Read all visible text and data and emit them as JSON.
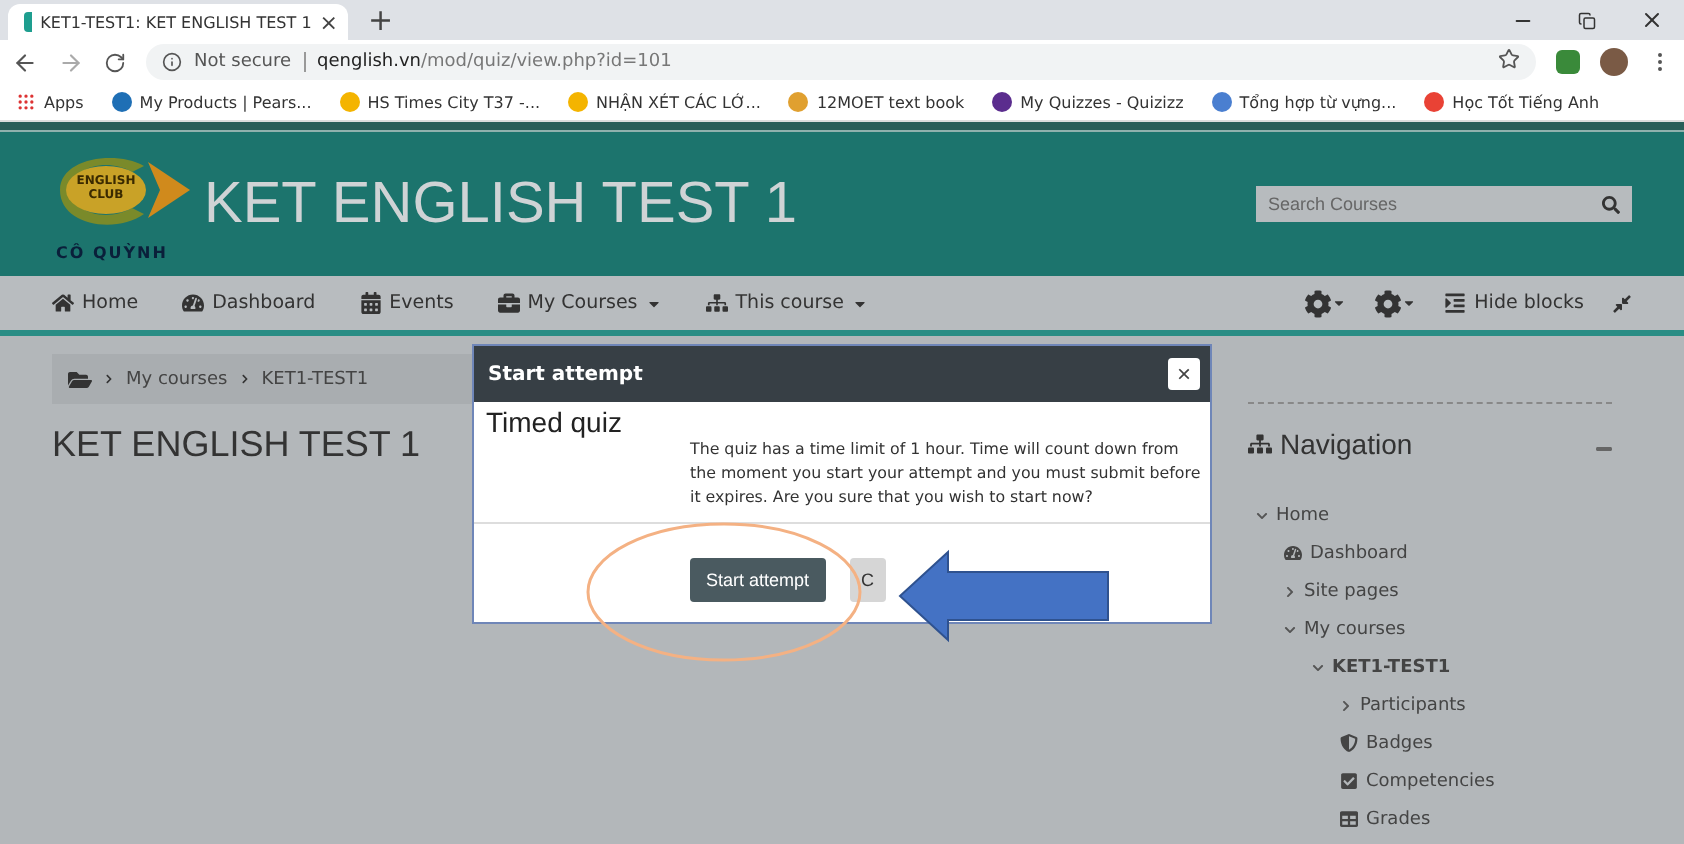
{
  "browser": {
    "tab": {
      "title": "KET1-TEST1: KET ENGLISH TEST 1",
      "close": "×"
    },
    "new_tab": "+",
    "security": "Not secure",
    "url_host": "qenglish.vn",
    "url_path": "/mod/quiz/view.php?id=101",
    "bookmarks": [
      "Apps",
      "My Products | Pears...",
      "HS Times City T37 -...",
      "NHẬN XÉT CÁC LỚ...",
      "12MOET text book",
      "My Quizzes - Quizizz",
      "Tổng hợp từ vựng...",
      "Học Tốt Tiếng Anh"
    ]
  },
  "header": {
    "logo_badge": "ENGLISH CLUB",
    "logo_caption": "CÔ QUỲNH",
    "title": "KET ENGLISH TEST 1",
    "search": {
      "placeholder": "Search Courses"
    }
  },
  "navbar": {
    "items": [
      {
        "label": "Home",
        "has_menu": false
      },
      {
        "label": "Dashboard",
        "has_menu": false
      },
      {
        "label": "Events",
        "has_menu": false
      },
      {
        "label": "My Courses",
        "has_menu": true
      },
      {
        "label": "This course",
        "has_menu": true
      }
    ],
    "hide_blocks": "Hide blocks"
  },
  "breadcrumb": [
    "My courses",
    "KET1-TEST1"
  ],
  "page_title": "KET ENGLISH TEST 1",
  "navigation": {
    "title": "Navigation",
    "tree": [
      {
        "label": "Home",
        "kind": "branch",
        "expanded": true,
        "current": false,
        "children": [
          {
            "label": "Dashboard",
            "kind": "leaf",
            "current": false
          },
          {
            "label": "Site pages",
            "kind": "branch",
            "expanded": false,
            "current": false
          },
          {
            "label": "My courses",
            "kind": "branch",
            "expanded": true,
            "current": false,
            "children": [
              {
                "label": "KET1-TEST1",
                "kind": "branch",
                "expanded": true,
                "current": true,
                "children": [
                  {
                    "label": "Participants",
                    "kind": "branch",
                    "expanded": false,
                    "current": false
                  },
                  {
                    "label": "Badges",
                    "kind": "leaf",
                    "current": false
                  },
                  {
                    "label": "Competencies",
                    "kind": "leaf",
                    "current": false
                  },
                  {
                    "label": "Grades",
                    "kind": "leaf",
                    "current": false
                  }
                ]
              }
            ]
          }
        ]
      }
    ]
  },
  "dialog": {
    "title": "Start attempt",
    "close": "×",
    "heading": "Timed quiz",
    "message": "The quiz has a time limit of 1 hour. Time will count down from the moment you start your attempt and you must submit before it expires. Are you sure that you wish to start now?",
    "buttons": [
      {
        "label": "Start attempt",
        "kind": "primary"
      },
      {
        "label": "C",
        "kind": "secondary"
      }
    ]
  }
}
